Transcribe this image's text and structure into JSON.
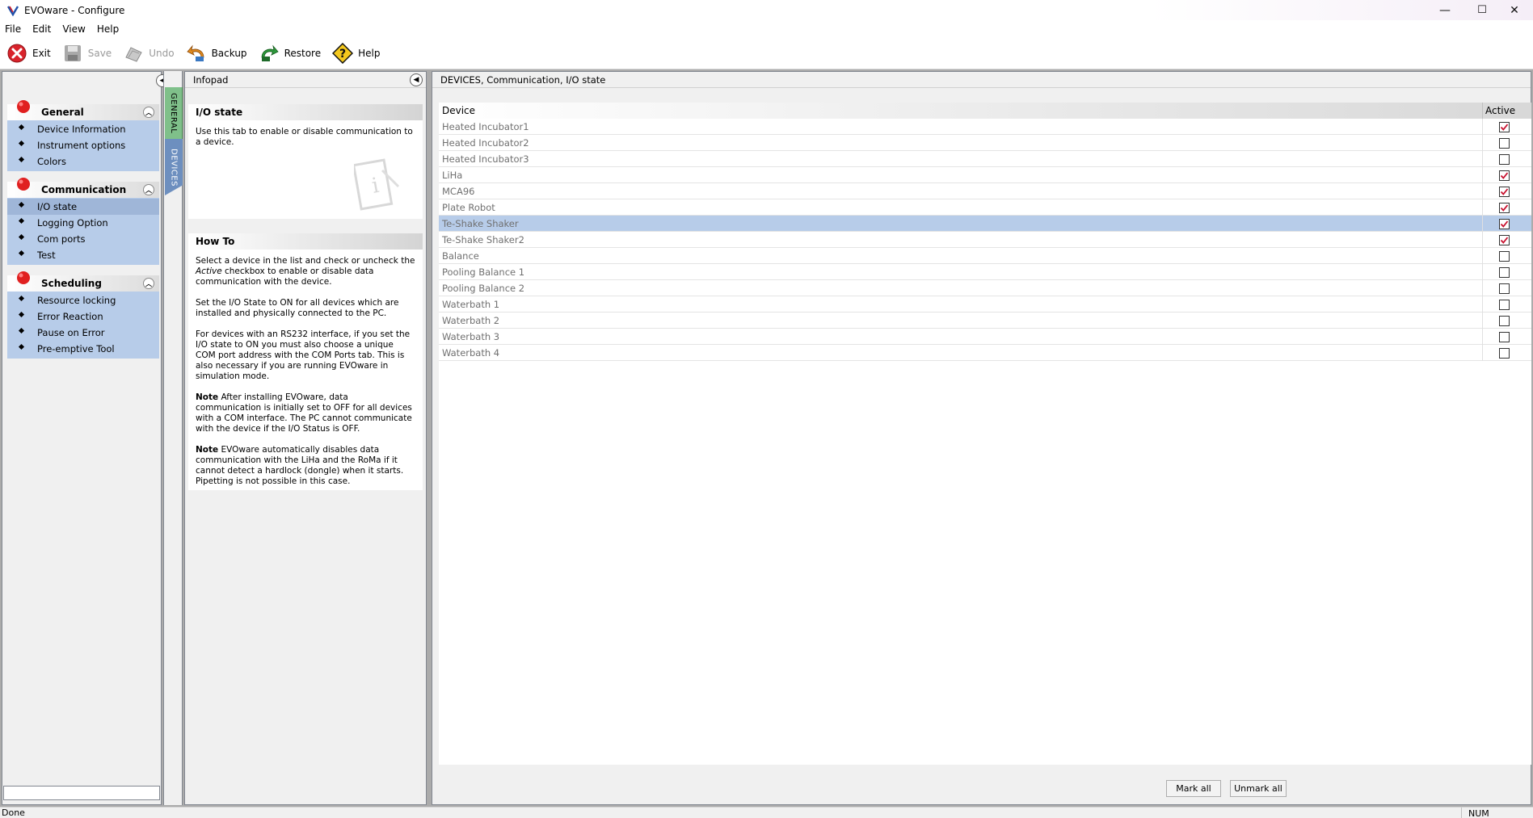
{
  "window": {
    "title": "EVOware - Configure",
    "minimize": "—",
    "maximize": "☐",
    "close": "✕"
  },
  "menu": [
    "File",
    "Edit",
    "View",
    "Help"
  ],
  "toolbar": {
    "exit": "Exit",
    "save": "Save",
    "undo": "Undo",
    "backup": "Backup",
    "restore": "Restore",
    "help": "Help"
  },
  "sidebar": {
    "groups": [
      {
        "title": "General",
        "items": [
          "Device Information",
          "Instrument options",
          "Colors"
        ]
      },
      {
        "title": "Communication",
        "items": [
          "I/O state",
          "Logging Option",
          "Com ports",
          "Test"
        ]
      },
      {
        "title": "Scheduling",
        "items": [
          "Resource locking",
          "Error Reaction",
          "Pause on Error",
          "Pre-emptive Tool"
        ]
      }
    ],
    "selected": "I/O state",
    "search_value": ""
  },
  "tabs": {
    "general": "GENERAL",
    "devices": "DEVICES"
  },
  "infopad": {
    "header": "Infopad",
    "section1": {
      "title": "I/O state",
      "text": "Use this tab to enable or disable communication to a device."
    },
    "section2": {
      "title": "How To",
      "p1_a": "Select a device in the list and check or uncheck the ",
      "p1_em": "Active",
      "p1_b": " checkbox to enable or disable data communication with the device.",
      "p2": "Set the I/O State to ON for all devices which are installed and physically connected to the PC.",
      "p3": "For devices with an RS232 interface, if you set the I/O state to ON you must also choose a unique COM port address with the COM Ports tab. This is also necessary if you are running EVOware in simulation mode.",
      "p4_bold": "Note",
      "p4": " After installing EVOware, data communication is initially set to OFF for all devices with a COM interface. The PC cannot communicate with the device if the I/O Status is OFF.",
      "p5_bold": "Note",
      "p5": " EVOware automatically disables data communication with the LiHa and the RoMa if it cannot detect a hardlock (dongle) when it starts. Pipetting is not possible in this case."
    }
  },
  "content": {
    "header": "DEVICES, Communication, I/O state",
    "columns": {
      "device": "Device",
      "active": "Active"
    },
    "devices": [
      {
        "name": "Heated Incubator1",
        "active": true
      },
      {
        "name": "Heated Incubator2",
        "active": false
      },
      {
        "name": "Heated Incubator3",
        "active": false
      },
      {
        "name": "LiHa",
        "active": true
      },
      {
        "name": "MCA96",
        "active": true
      },
      {
        "name": "Plate Robot",
        "active": true
      },
      {
        "name": "Te-Shake Shaker",
        "active": true
      },
      {
        "name": "Te-Shake Shaker2",
        "active": true
      },
      {
        "name": "Balance",
        "active": false
      },
      {
        "name": "Pooling Balance 1",
        "active": false
      },
      {
        "name": "Pooling Balance 2",
        "active": false
      },
      {
        "name": "Waterbath 1",
        "active": false
      },
      {
        "name": "Waterbath 2",
        "active": false
      },
      {
        "name": "Waterbath 3",
        "active": false
      },
      {
        "name": "Waterbath 4",
        "active": false
      }
    ],
    "selected_device": "Te-Shake Shaker",
    "mark_all": "Mark all",
    "unmark_all": "Unmark all"
  },
  "status": {
    "text": "Done",
    "num": "NUM"
  },
  "colors": {
    "selection": "#b7cce9",
    "check_red": "#c8102e"
  }
}
